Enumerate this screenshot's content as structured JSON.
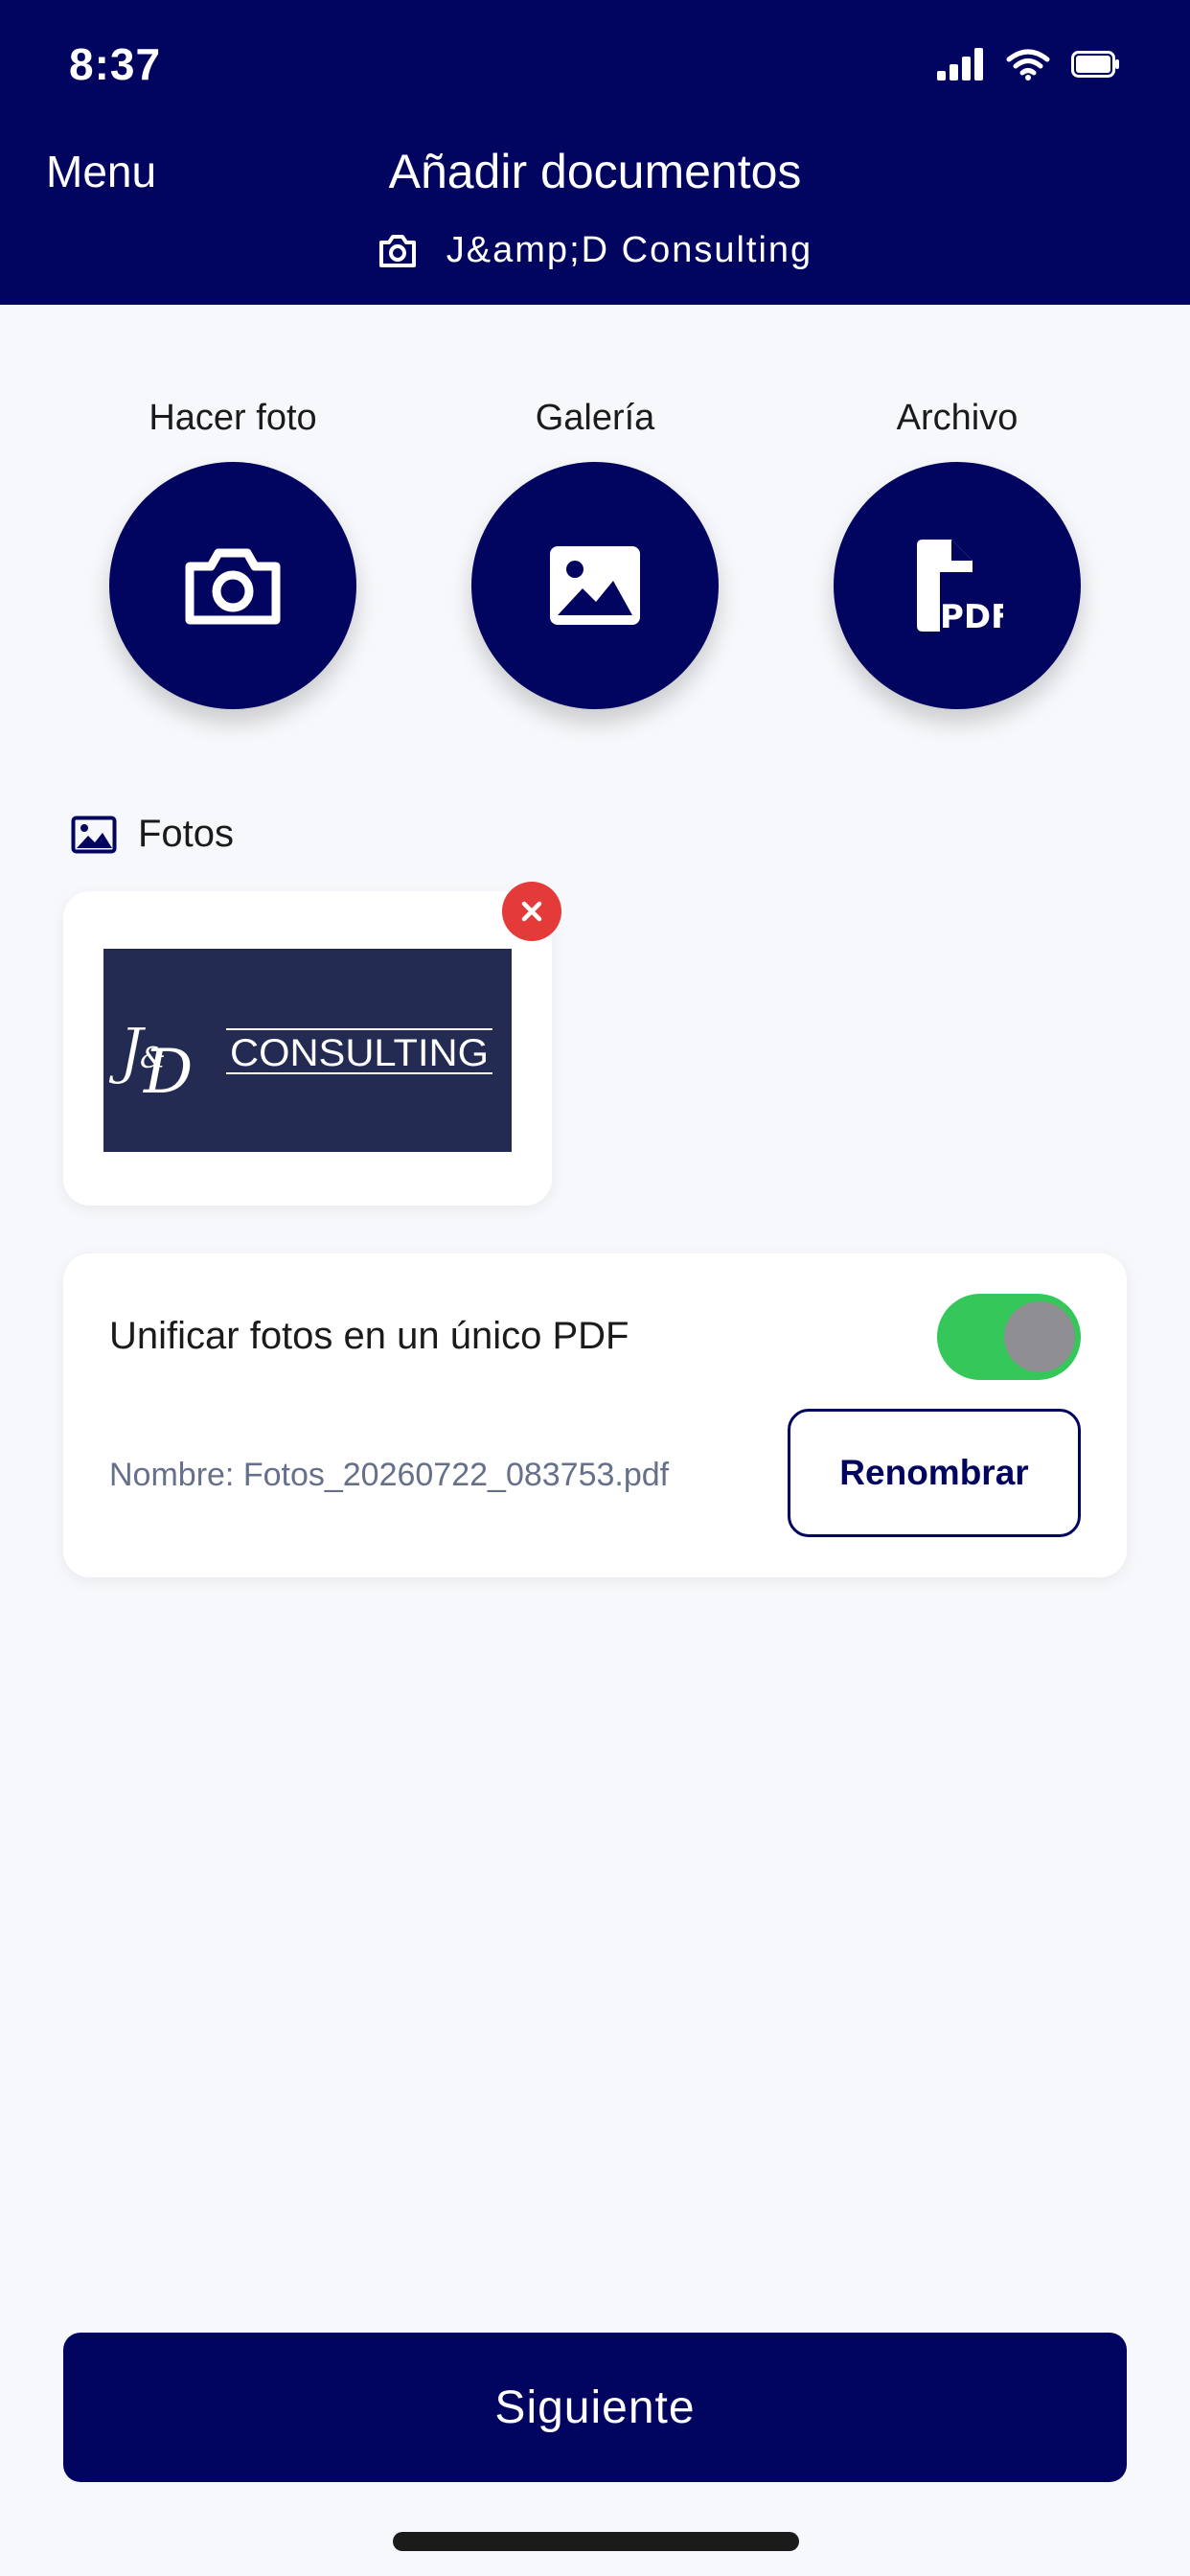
{
  "status_bar": {
    "time": "8:37"
  },
  "header": {
    "menu_label": "Menu",
    "title": "Añadir documentos",
    "subtitle": "J&amp;D Consulting",
    "background": "#020560"
  },
  "actions": [
    {
      "label": "Hacer foto",
      "icon": "camera-icon"
    },
    {
      "label": "Galería",
      "icon": "image-icon"
    },
    {
      "label": "Archivo",
      "icon": "pdf-file-icon"
    }
  ],
  "photos_section": {
    "title": "Fotos",
    "items": [
      {
        "logo_text": "CONSULTING"
      }
    ]
  },
  "merge": {
    "label": "Unificar fotos en un único PDF",
    "enabled": true,
    "filename": "Nombre: Fotos_20260722_083753.pdf",
    "rename_label": "Renombrar"
  },
  "footer": {
    "next_label": "Siguiente"
  },
  "colors": {
    "primary": "#020560",
    "toggle_on": "#35c759",
    "remove": "#e53a3a"
  }
}
